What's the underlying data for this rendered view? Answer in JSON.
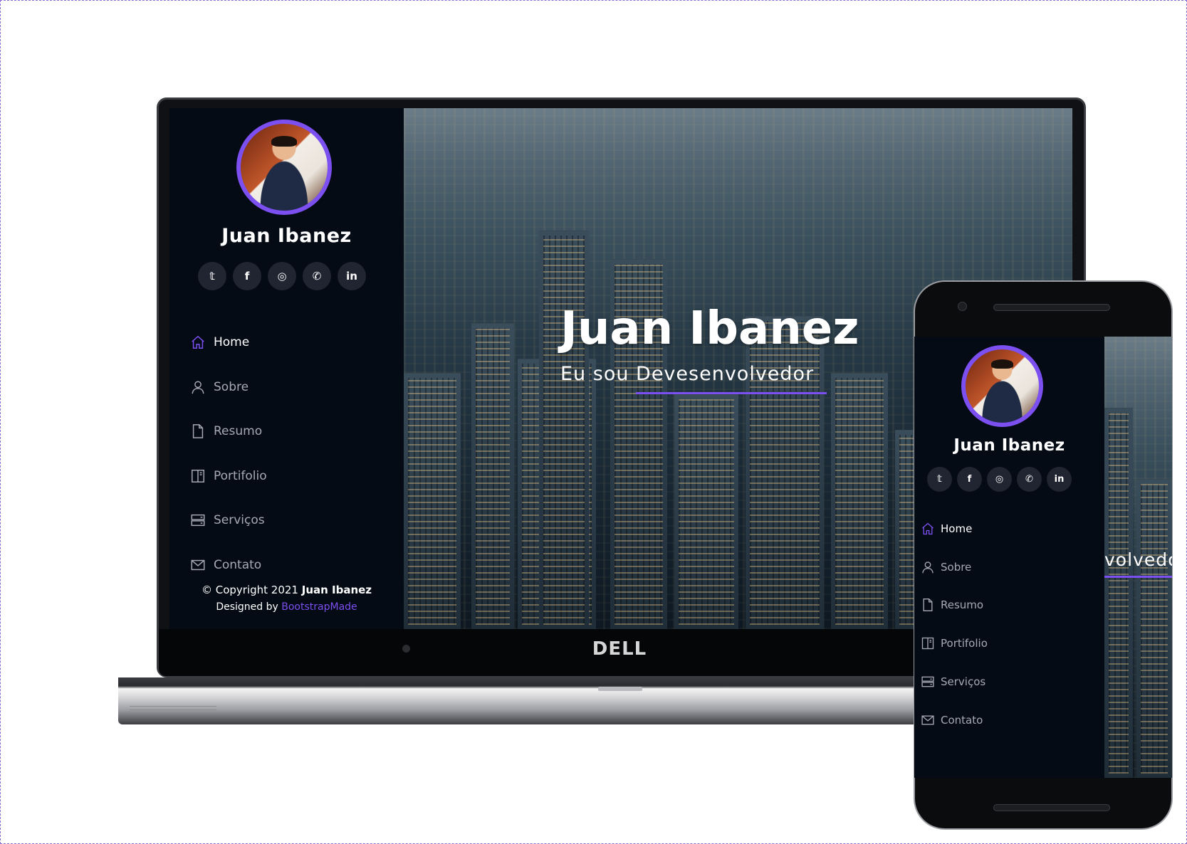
{
  "profile": {
    "name": "Juan Ibanez"
  },
  "social": [
    {
      "icon": "twitter-icon",
      "glyph": "𝕥"
    },
    {
      "icon": "facebook-icon",
      "glyph": "f"
    },
    {
      "icon": "instagram-icon",
      "glyph": "◎"
    },
    {
      "icon": "whatsapp-icon",
      "glyph": "✆"
    },
    {
      "icon": "linkedin-icon",
      "glyph": "in"
    }
  ],
  "nav": [
    {
      "label": "Home",
      "icon": "home-icon",
      "active": true
    },
    {
      "label": "Sobre",
      "icon": "user-icon",
      "active": false
    },
    {
      "label": "Resumo",
      "icon": "file-icon",
      "active": false
    },
    {
      "label": "Portifolio",
      "icon": "book-icon",
      "active": false
    },
    {
      "label": "Serviços",
      "icon": "server-icon",
      "active": false
    },
    {
      "label": "Contato",
      "icon": "envelope-icon",
      "active": false
    }
  ],
  "hero": {
    "title": "Juan Ibanez",
    "subtitle": "Eu sou Devesenvolvedor",
    "subtitle_cropped": "volvedo"
  },
  "footer": {
    "copyright_prefix": "© Copyright 2021 ",
    "copyright_name": "Juan Ibanez",
    "designed_prefix": "Designed by ",
    "designed_link": "BootstrapMade"
  },
  "device": {
    "laptop_brand": "DELL"
  },
  "colors": {
    "accent": "#7b4ff0",
    "sidebar_bg": "#040b14",
    "social_bg": "#212431",
    "nav_text": "#a8a9b4"
  }
}
